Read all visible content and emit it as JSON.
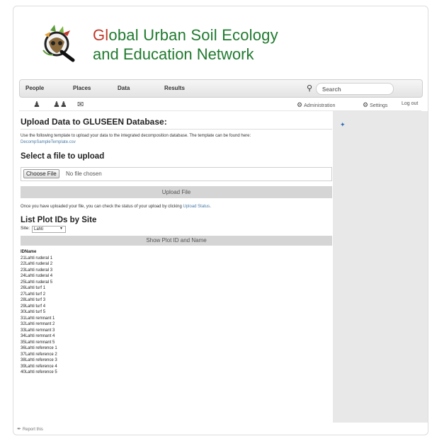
{
  "header": {
    "title_line1_first": "Gl",
    "title_line1_rest": "obal Urban Soil Ecology",
    "title_line2": "and Education Network"
  },
  "nav": {
    "items": [
      "People",
      "Places",
      "Data",
      "Results"
    ],
    "search_placeholder": "Search"
  },
  "toolbar": {
    "icons": [
      "user-icon",
      "group-icon",
      "mail-icon"
    ],
    "links": [
      "Administration",
      "Settings",
      "Log out"
    ]
  },
  "main": {
    "page_title": "Upload Data to GLUSEEN Database:",
    "intro_text": "Use the following template to upload your data to the integrated decomposition database. The template can be found here:",
    "template_link": "DecompSampleTemplate.csv",
    "select_heading": "Select a file to upload",
    "choose_file_label": "Choose File",
    "no_file_text": "No file chosen",
    "upload_button": "Upload File",
    "status_text": "Once you have uploaded your file, you can check the status of your upload by clicking",
    "status_link": "Upload Status",
    "status_period": ".",
    "plot_heading": "List Plot IDs by Site",
    "site_label": "Site:",
    "site_value": "Lahti",
    "show_button": "Show Plot ID and Name",
    "table_header_id": "ID",
    "table_header_name": "Name",
    "plots": [
      {
        "id": "21",
        "name": "Lahti ruderal 1"
      },
      {
        "id": "22",
        "name": "Lahti ruderal 2"
      },
      {
        "id": "23",
        "name": "Lahti ruderal 3"
      },
      {
        "id": "24",
        "name": "Lahti ruderal 4"
      },
      {
        "id": "25",
        "name": "Lahti ruderal 5"
      },
      {
        "id": "26",
        "name": "Lahti turf 1"
      },
      {
        "id": "27",
        "name": "Lahti turf 2"
      },
      {
        "id": "28",
        "name": "Lahti turf 3"
      },
      {
        "id": "29",
        "name": "Lahti turf 4"
      },
      {
        "id": "30",
        "name": "Lahti turf 5"
      },
      {
        "id": "31",
        "name": "Lahti remnant 1"
      },
      {
        "id": "32",
        "name": "Lahti remnant 2"
      },
      {
        "id": "33",
        "name": "Lahti remnant 3"
      },
      {
        "id": "34",
        "name": "Lahti remnant 4"
      },
      {
        "id": "35",
        "name": "Lahti remnant 5"
      },
      {
        "id": "36",
        "name": "Lahti reference 1"
      },
      {
        "id": "37",
        "name": "Lahti reference 2"
      },
      {
        "id": "38",
        "name": "Lahti reference 3"
      },
      {
        "id": "39",
        "name": "Lahti reference 4"
      },
      {
        "id": "40",
        "name": "Lahti reference 5"
      }
    ]
  },
  "footer": {
    "report_link": "Report this"
  },
  "colors": {
    "title_green": "#1f7a2e",
    "title_red": "#c0392b",
    "link_blue": "#4a7aa6",
    "sidebar_bg": "#e8e8e8"
  }
}
